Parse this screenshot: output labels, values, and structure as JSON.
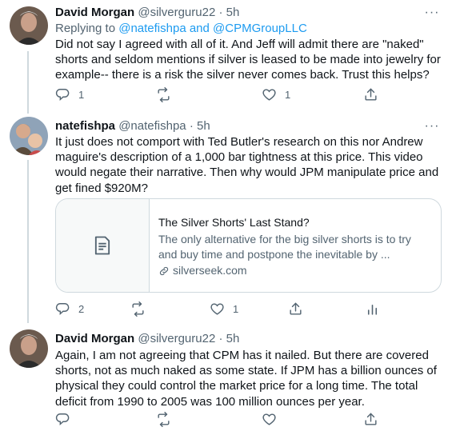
{
  "tweets": [
    {
      "name": "David Morgan",
      "handle": "@silverguru22",
      "dot": "·",
      "time": "5h",
      "more": "···",
      "reply_prefix": "Replying to",
      "reply_users": "@natefishpa and @CPMGroupLLC",
      "text": "Did not say I agreed with all of it.  And Jeff will admit there are \"naked\" shorts and seldom mentions if silver is leased to be made into jewelry for example-- there is a risk the silver never comes back. Trust this helps?",
      "reply_count": "1",
      "retweet_count": "",
      "like_count": "1"
    },
    {
      "name": "natefishpa",
      "handle": "@natefishpa",
      "dot": "·",
      "time": "5h",
      "more": "···",
      "text": "It just does not comport with Ted Butler's research on this nor Andrew maguire's description of a 1,000 bar tightness at this price. This video would negate their narrative. Then why would JPM manipulate price and get fined $920M?",
      "card": {
        "title": "The Silver Shorts' Last Stand?",
        "description": "The only alternative for the big silver shorts is to try and buy time and postpone the inevitable by ...",
        "domain": "silverseek.com"
      },
      "reply_count": "2",
      "retweet_count": "",
      "like_count": "1"
    },
    {
      "name": "David Morgan",
      "handle": "@silverguru22",
      "dot": "·",
      "time": "5h",
      "more": "···",
      "text": "Again,  I am not agreeing that CPM has it nailed.  But there are covered shorts, not as much naked as some state.  If JPM has a billion ounces of physical they could control the market price for a long time.  The total deficit from 1990 to 2005 was 100 million ounces per year.",
      "reply_count": "",
      "retweet_count": "",
      "like_count": ""
    }
  ],
  "colors": {
    "accent": "#1d9bf0",
    "secondary": "#536471",
    "border": "#cfd9de"
  }
}
